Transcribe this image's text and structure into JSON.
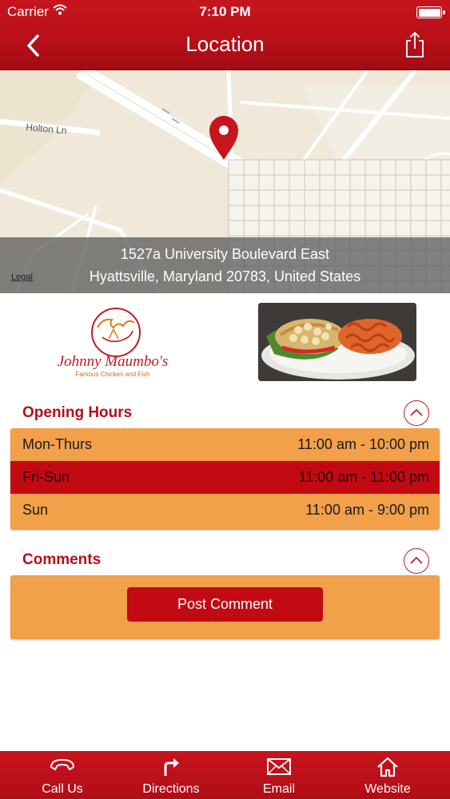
{
  "status_bar": {
    "carrier": "Carrier",
    "time": "7:10 PM"
  },
  "nav": {
    "title": "Location",
    "back_icon": "chevron-left-icon",
    "share_icon": "share-icon"
  },
  "map": {
    "street_label": "Holton Ln",
    "address_line1": "1527a University Boulevard East",
    "address_line2": "Hyattsville, Maryland 20783, United States",
    "legal": "Legal",
    "pin_color": "#c8141e"
  },
  "logo": {
    "name": "Johnny Maumbo's",
    "tagline": "Famous Chicken and Fish"
  },
  "opening_hours": {
    "title": "Opening Hours",
    "rows": [
      {
        "day": "Mon-Thurs",
        "hours": "11:00 am - 10:00 pm",
        "highlighted": false
      },
      {
        "day": "Fri-Sun",
        "hours": "11:00 am - 11:00 pm",
        "highlighted": true
      },
      {
        "day": "Sun",
        "hours": "11:00 am - 9:00 pm",
        "highlighted": false
      }
    ]
  },
  "comments": {
    "title": "Comments",
    "post_button": "Post Comment"
  },
  "tabbar": {
    "items": [
      {
        "label": "Call Us",
        "icon": "phone-icon"
      },
      {
        "label": "Directions",
        "icon": "directions-icon"
      },
      {
        "label": "Email",
        "icon": "email-icon"
      },
      {
        "label": "Website",
        "icon": "home-icon"
      }
    ]
  },
  "colors": {
    "brand_red": "#c20a12",
    "panel_orange": "#f2a04a",
    "title_red": "#b3101a"
  }
}
